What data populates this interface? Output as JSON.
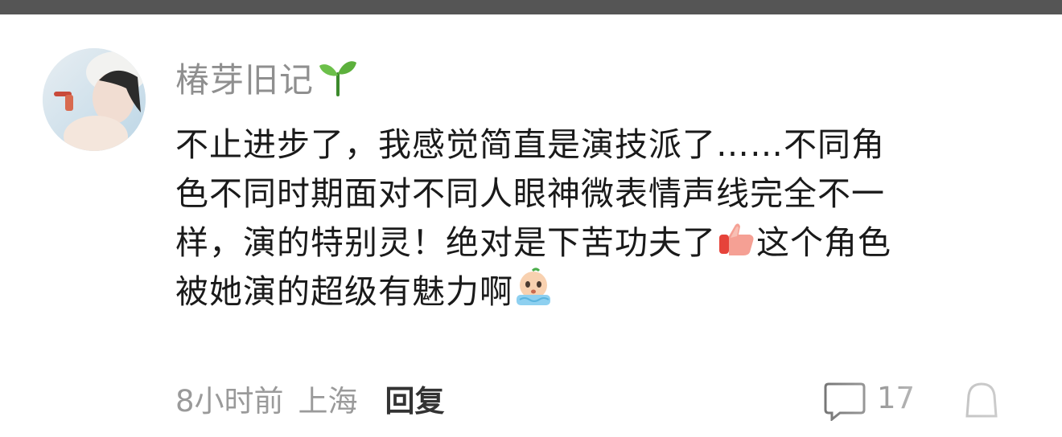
{
  "comment": {
    "username": "椿芽旧记",
    "username_badge_icon": "sprout-icon",
    "text_lines": [
      "不止进步了，我感觉简直是演技派了……不同角",
      "色不同时期面对不同人眼神微表情声线完全不一",
      "样，演的特别灵！绝对是下苦功夫了",
      "这个角色",
      "被她演的超级有魅力啊"
    ],
    "emojis": {
      "line3": "thumbs-up-emoji",
      "line4": "crying-face-emoji"
    },
    "time": "8小时前",
    "location": "上海",
    "reply_label": "回复",
    "like_count": "17"
  },
  "colors": {
    "top_bar": "#555555",
    "username": "#8f8f8f",
    "text": "#1a1a1a",
    "meta": "#9a9a9a",
    "reply": "#333333"
  }
}
